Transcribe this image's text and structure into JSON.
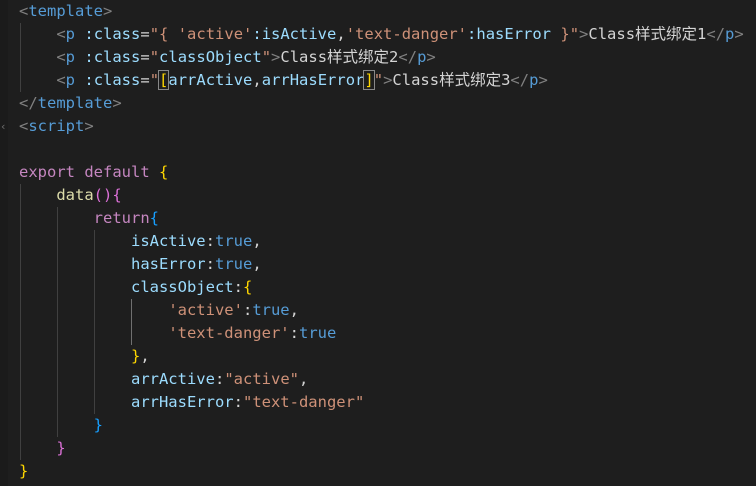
{
  "editor": {
    "colors": {
      "background": "#1e1e1e",
      "tag": "#569cd6",
      "attribute": "#9cdcfe",
      "string": "#ce9178",
      "keyword": "#c586c0",
      "function": "#dcdcaa",
      "bracket_level1": "#ffd700",
      "bracket_level2": "#da70d6",
      "bracket_level3": "#179fff"
    },
    "lines": [
      {
        "fold": "",
        "tokens": [
          [
            "t-br",
            "<"
          ],
          [
            "t-tag",
            "template"
          ],
          [
            "t-br",
            ">"
          ]
        ]
      },
      {
        "fold": "",
        "tokens": [
          [
            "t-pun",
            "    "
          ],
          [
            "t-br",
            "<"
          ],
          [
            "t-tag",
            "p"
          ],
          [
            "t-pun",
            " "
          ],
          [
            "t-attr",
            ":class"
          ],
          [
            "t-pun",
            "="
          ],
          [
            "t-str",
            "\"{ "
          ],
          [
            "t-str",
            "'active'"
          ],
          [
            "t-attr",
            ":isActive"
          ],
          [
            "t-pun",
            ","
          ],
          [
            "t-str",
            "'text-danger'"
          ],
          [
            "t-attr",
            ":hasError"
          ],
          [
            "t-str",
            " }\""
          ],
          [
            "t-br",
            ">"
          ],
          [
            "t-ptx",
            "Class样式绑定1"
          ],
          [
            "t-br",
            "</"
          ],
          [
            "t-tag",
            "p"
          ],
          [
            "t-br",
            ">"
          ]
        ]
      },
      {
        "fold": "",
        "tokens": [
          [
            "t-pun",
            "    "
          ],
          [
            "t-br",
            "<"
          ],
          [
            "t-tag",
            "p"
          ],
          [
            "t-pun",
            " "
          ],
          [
            "t-attr",
            ":class"
          ],
          [
            "t-pun",
            "="
          ],
          [
            "t-str",
            "\""
          ],
          [
            "t-attr",
            "classObject"
          ],
          [
            "t-str",
            "\""
          ],
          [
            "t-br",
            ">"
          ],
          [
            "t-ptx",
            "Class样式绑定2"
          ],
          [
            "t-br",
            "</"
          ],
          [
            "t-tag",
            "p"
          ],
          [
            "t-br",
            ">"
          ]
        ]
      },
      {
        "fold": "",
        "tokens": [
          [
            "t-pun",
            "    "
          ],
          [
            "t-br",
            "<"
          ],
          [
            "t-tag",
            "p"
          ],
          [
            "t-pun",
            " "
          ],
          [
            "t-attr",
            ":class"
          ],
          [
            "t-pun",
            "="
          ],
          [
            "t-str",
            "\""
          ],
          [
            "t-b1 bkt-outline",
            "["
          ],
          [
            "t-attr",
            "arrActive"
          ],
          [
            "t-pun",
            ","
          ],
          [
            "t-attr",
            "arrHasError"
          ],
          [
            "t-b1 bkt-outline",
            "]"
          ],
          [
            "t-str",
            "\""
          ],
          [
            "t-br",
            ">"
          ],
          [
            "t-ptx",
            "Class样式绑定3"
          ],
          [
            "t-br",
            "</"
          ],
          [
            "t-tag",
            "p"
          ],
          [
            "t-br",
            ">"
          ]
        ]
      },
      {
        "fold": "",
        "tokens": [
          [
            "t-br",
            "</"
          ],
          [
            "t-tag",
            "template"
          ],
          [
            "t-br",
            ">"
          ]
        ]
      },
      {
        "fold": "‹",
        "tokens": [
          [
            "t-br",
            "<"
          ],
          [
            "t-tag",
            "script"
          ],
          [
            "t-br",
            ">"
          ]
        ]
      },
      {
        "fold": "",
        "tokens": []
      },
      {
        "fold": "",
        "tokens": [
          [
            "t-kw",
            "export"
          ],
          [
            "t-pun",
            " "
          ],
          [
            "t-kw",
            "default"
          ],
          [
            "t-pun",
            " "
          ],
          [
            "t-b1",
            "{"
          ]
        ]
      },
      {
        "fold": "",
        "tokens": [
          [
            "t-pun",
            "    "
          ],
          [
            "t-fn",
            "data"
          ],
          [
            "t-b2",
            "()"
          ],
          [
            "t-b2",
            "{"
          ]
        ]
      },
      {
        "fold": "",
        "tokens": [
          [
            "t-pun",
            "        "
          ],
          [
            "t-kw",
            "return"
          ],
          [
            "t-b3",
            "{"
          ]
        ]
      },
      {
        "fold": "",
        "tokens": [
          [
            "t-pun",
            "            "
          ],
          [
            "t-prop",
            "isActive"
          ],
          [
            "t-pun",
            ":"
          ],
          [
            "t-bool",
            "true"
          ],
          [
            "t-pun",
            ","
          ]
        ]
      },
      {
        "fold": "",
        "tokens": [
          [
            "t-pun",
            "            "
          ],
          [
            "t-prop",
            "hasError"
          ],
          [
            "t-pun",
            ":"
          ],
          [
            "t-bool",
            "true"
          ],
          [
            "t-pun",
            ","
          ]
        ]
      },
      {
        "fold": "",
        "tokens": [
          [
            "t-pun",
            "            "
          ],
          [
            "t-prop",
            "classObject"
          ],
          [
            "t-pun",
            ":"
          ],
          [
            "t-b1",
            "{"
          ]
        ]
      },
      {
        "fold": "",
        "tokens": [
          [
            "t-pun",
            "                "
          ],
          [
            "t-str",
            "'active'"
          ],
          [
            "t-pun",
            ":"
          ],
          [
            "t-bool",
            "true"
          ],
          [
            "t-pun",
            ","
          ]
        ]
      },
      {
        "fold": "",
        "tokens": [
          [
            "t-pun",
            "                "
          ],
          [
            "t-str",
            "'text-danger'"
          ],
          [
            "t-pun",
            ":"
          ],
          [
            "t-bool",
            "true"
          ]
        ]
      },
      {
        "fold": "",
        "tokens": [
          [
            "t-pun",
            "            "
          ],
          [
            "t-b1",
            "}"
          ],
          [
            "t-pun",
            ","
          ]
        ]
      },
      {
        "fold": "",
        "tokens": [
          [
            "t-pun",
            "            "
          ],
          [
            "t-prop",
            "arrActive"
          ],
          [
            "t-pun",
            ":"
          ],
          [
            "t-str",
            "\"active\""
          ],
          [
            "t-pun",
            ","
          ]
        ]
      },
      {
        "fold": "",
        "tokens": [
          [
            "t-pun",
            "            "
          ],
          [
            "t-prop",
            "arrHasError"
          ],
          [
            "t-pun",
            ":"
          ],
          [
            "t-str",
            "\"text-danger\""
          ]
        ]
      },
      {
        "fold": "",
        "tokens": [
          [
            "t-pun",
            "        "
          ],
          [
            "t-b3",
            "}"
          ]
        ]
      },
      {
        "fold": "",
        "tokens": [
          [
            "t-pun",
            "    "
          ],
          [
            "t-b2",
            "}"
          ]
        ]
      },
      {
        "fold": "",
        "tokens": [
          [
            "t-b1",
            "}"
          ]
        ]
      }
    ]
  }
}
